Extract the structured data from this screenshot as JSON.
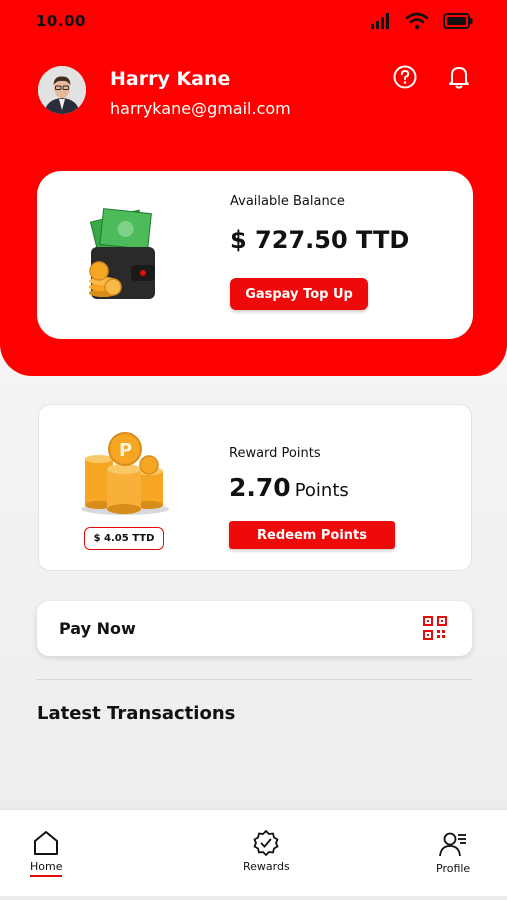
{
  "status_bar": {
    "time": "10.00"
  },
  "user": {
    "name": "Harry Kane",
    "email": "harrykane@gmail.com"
  },
  "header_icons": [
    "help-icon",
    "bell-icon"
  ],
  "balance": {
    "label": "Available Balance",
    "amount": "$ 727.50 TTD",
    "topup_label": "Gaspay Top Up"
  },
  "rewards": {
    "label": "Reward Points",
    "value": "2.70",
    "unit": "Points",
    "ttd_value": "$ 4.05 TTD",
    "redeem_label": "Redeem Points"
  },
  "pay_now": {
    "label": "Pay Now",
    "icon": "qr-code-icon"
  },
  "transactions": {
    "title": "Latest Transactions"
  },
  "nav": {
    "items": [
      {
        "label": "Home",
        "icon": "home-icon",
        "active": true
      },
      {
        "label": "Rewards",
        "icon": "rewards-badge-icon",
        "active": false
      },
      {
        "label": "Profile",
        "icon": "profile-icon",
        "active": false
      }
    ]
  },
  "colors": {
    "brand_red": "#fe0000",
    "button_red": "#ee0a0a",
    "money_green": "#3aa845",
    "coin_gold": "#f6a623"
  }
}
